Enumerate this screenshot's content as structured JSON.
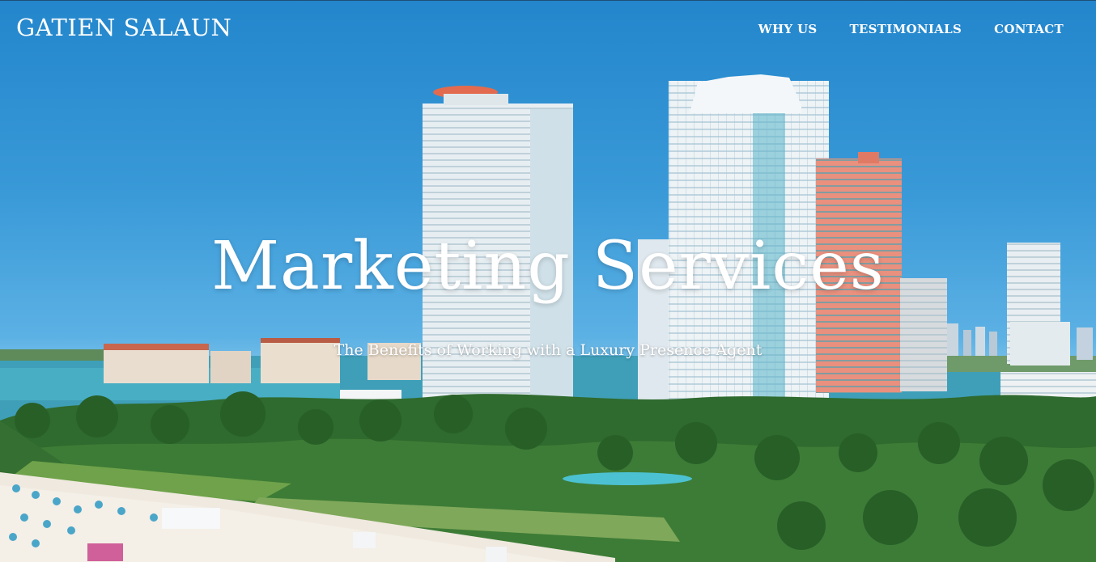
{
  "header": {
    "brand": "GATIEN SALAUN",
    "nav": [
      {
        "label": "WHY US"
      },
      {
        "label": "TESTIMONIALS"
      },
      {
        "label": "CONTACT"
      }
    ]
  },
  "hero": {
    "title": "Marketing Services",
    "subtitle": "The Benefits of Working with a Luxury Presence Agent"
  },
  "colors": {
    "sky": "#2b8fd0",
    "text": "#ffffff"
  }
}
